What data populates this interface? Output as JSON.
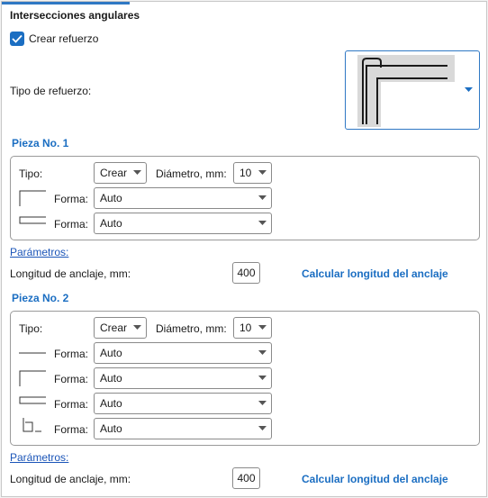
{
  "header": {
    "title": "Intersecciones angulares"
  },
  "reinforce": {
    "checkbox_label": "Crear refuerzo",
    "checked": true
  },
  "reinforce_type": {
    "label": "Tipo de refuerzo:"
  },
  "pieces": [
    {
      "heading": "Pieza No. 1",
      "tipo_label": "Tipo:",
      "tipo_value": "Crear",
      "diam_label": "Diámetro, mm:",
      "diam_value": "10",
      "rows": [
        {
          "shape_icon": "l-bracket-icon",
          "forma_label": "Forma:",
          "forma_value": "Auto"
        },
        {
          "shape_icon": "u-bracket-icon",
          "forma_label": "Forma:",
          "forma_value": "Auto"
        }
      ],
      "params_link": "Parámetros:",
      "anchor_label": "Longitud de anclaje, mm:",
      "anchor_value": "400",
      "calc_label": "Calcular longitud del anclaje"
    },
    {
      "heading": "Pieza No. 2",
      "tipo_label": "Tipo:",
      "tipo_value": "Crear",
      "diam_label": "Diámetro, mm:",
      "diam_value": "10",
      "rows": [
        {
          "shape_icon": "straight-line-icon",
          "forma_label": "Forma:",
          "forma_value": "Auto"
        },
        {
          "shape_icon": "l-bracket-icon",
          "forma_label": "Forma:",
          "forma_value": "Auto"
        },
        {
          "shape_icon": "u-bracket-icon",
          "forma_label": "Forma:",
          "forma_value": "Auto"
        },
        {
          "shape_icon": "hook-bracket-icon",
          "forma_label": "Forma:",
          "forma_value": "Auto"
        }
      ],
      "params_link": "Parámetros:",
      "anchor_label": "Longitud de anclaje, mm:",
      "anchor_value": "400",
      "calc_label": "Calcular longitud del anclaje"
    }
  ],
  "colors": {
    "accent": "#1b6ec2",
    "link": "#1b55b8",
    "border": "#9a9a9a"
  }
}
